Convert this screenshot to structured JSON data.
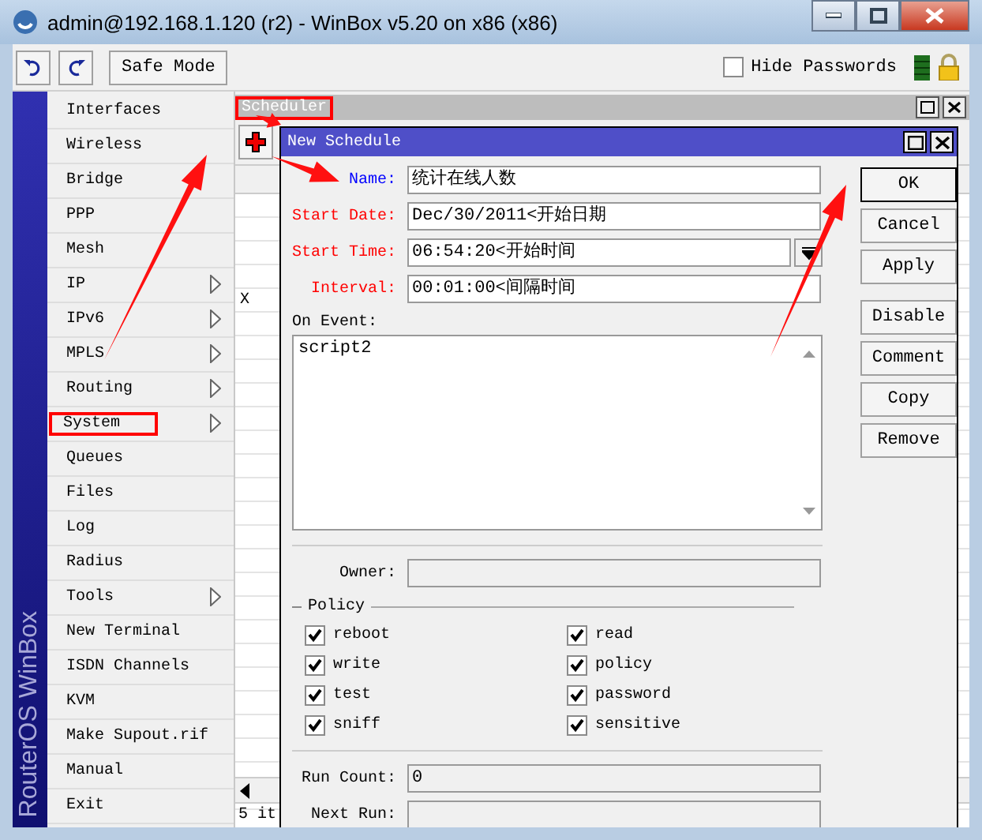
{
  "window": {
    "title": "admin@192.168.1.120 (r2) - WinBox v5.20 on x86 (x86)"
  },
  "toolbar": {
    "safe_mode": "Safe Mode",
    "hide_passwords": {
      "label": "Hide Passwords",
      "checked": false
    }
  },
  "brand": "RouterOS WinBox",
  "menu": [
    {
      "label": "Interfaces",
      "submenu": false,
      "highlighted": false
    },
    {
      "label": "Wireless",
      "submenu": false,
      "highlighted": false
    },
    {
      "label": "Bridge",
      "submenu": false,
      "highlighted": false
    },
    {
      "label": "PPP",
      "submenu": false,
      "highlighted": false
    },
    {
      "label": "Mesh",
      "submenu": false,
      "highlighted": false
    },
    {
      "label": "IP",
      "submenu": true,
      "highlighted": false
    },
    {
      "label": "IPv6",
      "submenu": true,
      "highlighted": false
    },
    {
      "label": "MPLS",
      "submenu": true,
      "highlighted": false
    },
    {
      "label": "Routing",
      "submenu": true,
      "highlighted": false
    },
    {
      "label": "System",
      "submenu": true,
      "highlighted": true
    },
    {
      "label": "Queues",
      "submenu": false,
      "highlighted": false
    },
    {
      "label": "Files",
      "submenu": false,
      "highlighted": false
    },
    {
      "label": "Log",
      "submenu": false,
      "highlighted": false
    },
    {
      "label": "Radius",
      "submenu": false,
      "highlighted": false
    },
    {
      "label": "Tools",
      "submenu": true,
      "highlighted": false
    },
    {
      "label": "New Terminal",
      "submenu": false,
      "highlighted": false
    },
    {
      "label": "ISDN Channels",
      "submenu": false,
      "highlighted": false
    },
    {
      "label": "KVM",
      "submenu": false,
      "highlighted": false
    },
    {
      "label": "Make Supout.rif",
      "submenu": false,
      "highlighted": false
    },
    {
      "label": "Manual",
      "submenu": false,
      "highlighted": false
    },
    {
      "label": "Exit",
      "submenu": false,
      "highlighted": false
    }
  ],
  "scheduler": {
    "title": "Scheduler",
    "highlighted": true,
    "table": {
      "cells": [
        "X"
      ]
    },
    "status": "5 it"
  },
  "dialog": {
    "title": "New Schedule",
    "fields": [
      {
        "label": "Name:",
        "value": "统计在线人数",
        "color": "#0000ff",
        "kind": "text"
      },
      {
        "label": "Start Date:",
        "value": "Dec/30/2011<开始日期",
        "color": "#ff0000",
        "kind": "text"
      },
      {
        "label": "Start Time:",
        "value": "06:54:20<开始时间",
        "color": "#ff0000",
        "kind": "dropdown"
      },
      {
        "label": "Interval:",
        "value": "00:01:00<间隔时间",
        "color": "#ff0000",
        "kind": "text"
      }
    ],
    "on_event": {
      "label": "On Event:",
      "value": "script2"
    },
    "owner": {
      "label": "Owner:"
    },
    "policy": {
      "label": "Policy",
      "items": [
        {
          "label": "reboot",
          "checked": true
        },
        {
          "label": "read",
          "checked": true
        },
        {
          "label": "write",
          "checked": true
        },
        {
          "label": "policy",
          "checked": true
        },
        {
          "label": "test",
          "checked": true
        },
        {
          "label": "password",
          "checked": true
        },
        {
          "label": "sniff",
          "checked": true
        },
        {
          "label": "sensitive",
          "checked": true
        }
      ]
    },
    "run_count": {
      "label": "Run Count:",
      "value": "0"
    },
    "next_run": {
      "label": "Next Run:"
    },
    "button_groups": [
      [
        {
          "label": "OK",
          "default": true
        },
        {
          "label": "Cancel",
          "default": false
        },
        {
          "label": "Apply",
          "default": false
        }
      ],
      [
        {
          "label": "Disable",
          "default": false
        },
        {
          "label": "Comment",
          "default": false
        },
        {
          "label": "Copy",
          "default": false
        },
        {
          "label": "Remove",
          "default": false
        }
      ]
    ]
  }
}
